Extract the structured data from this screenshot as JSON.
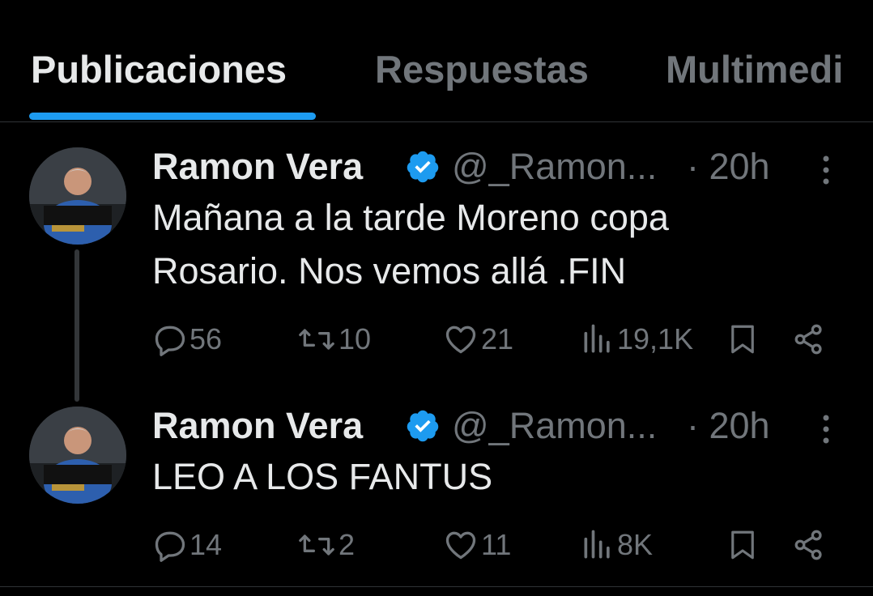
{
  "tabs": [
    {
      "label": "Publicaciones",
      "active": true
    },
    {
      "label": "Respuestas",
      "active": false
    },
    {
      "label": "Multimedi",
      "active": false
    }
  ],
  "colors": {
    "accent": "#1d9bf0",
    "muted": "#71767b",
    "text": "#e7e9ea",
    "background": "#000000"
  },
  "tweets": [
    {
      "name": "Ramon Vera",
      "handle": "@_Ramon...",
      "time": "· 20h",
      "text_lines": [
        "Mañana a la tarde Moreno copa",
        "Rosario. Nos vemos allá .FIN"
      ],
      "replies": "56",
      "reposts": "10",
      "likes": "21",
      "views": "19,1K",
      "icons": [
        "verified-badge-icon",
        "more-icon",
        "reply-icon",
        "repost-icon",
        "like-icon",
        "views-icon",
        "bookmark-icon",
        "share-icon"
      ]
    },
    {
      "name": "Ramon Vera",
      "handle": "@_Ramon...",
      "time": "· 20h",
      "text_lines": [
        "LEO A LOS FANTUS"
      ],
      "replies": "14",
      "reposts": "2",
      "likes": "11",
      "views": "8K",
      "icons": [
        "verified-badge-icon",
        "more-icon",
        "reply-icon",
        "repost-icon",
        "like-icon",
        "views-icon",
        "bookmark-icon",
        "share-icon"
      ]
    }
  ]
}
